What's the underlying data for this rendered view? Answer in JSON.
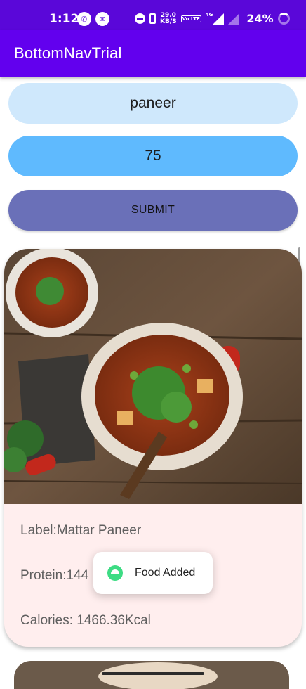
{
  "status_bar": {
    "time": "1:12",
    "net_speed_value": "29.0",
    "net_speed_unit": "KB/S",
    "volte_label": "Vo LTE",
    "network_type": "4G",
    "battery": "24%",
    "icons": [
      "whatsapp-icon",
      "messenger-icon",
      "dnd-icon",
      "vibrate-icon",
      "signal-icon",
      "battery-icon"
    ]
  },
  "app_bar": {
    "title": "BottomNavTrial"
  },
  "form": {
    "food_name": "paneer",
    "quantity": "75",
    "submit_label": "SUBMIT",
    "colors": {
      "name_field": "#cfe8fc",
      "qty_field": "#5fbafe",
      "submit": "#6a70b8"
    }
  },
  "result_card": {
    "label": "Label:Mattar Paneer",
    "protein": "Protein:144",
    "calories": "Calories:  1466.36Kcal",
    "image": "mattar-paneer-dish"
  },
  "toast": {
    "text": "Food Added",
    "icon": "android-icon"
  },
  "colors": {
    "status_bar": "#5a07d9",
    "app_bar": "#6200ee",
    "card_background": "#ffeeee"
  }
}
